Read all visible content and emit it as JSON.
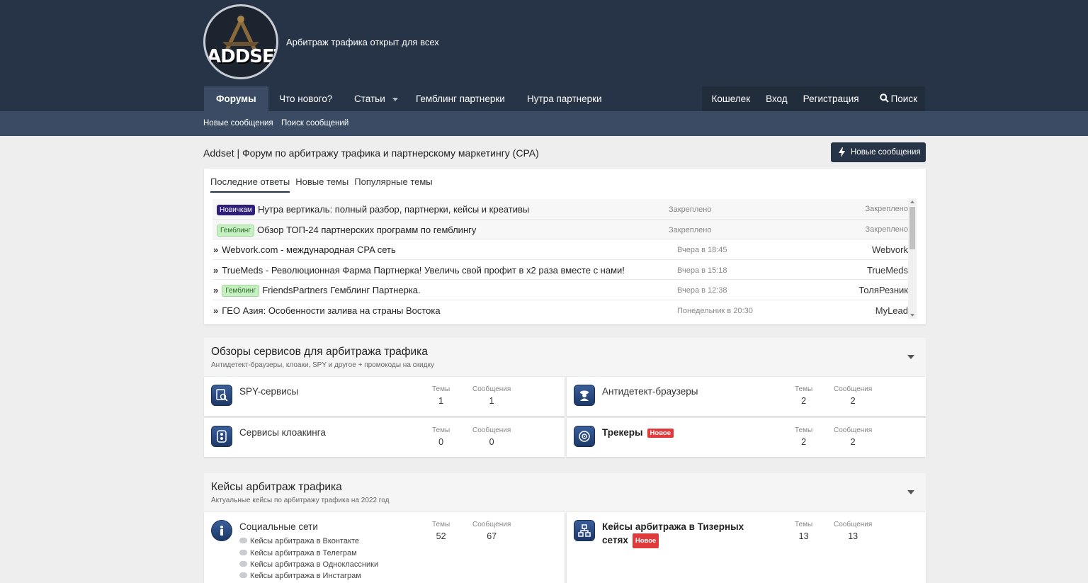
{
  "header": {
    "logo_text": "ADDSET",
    "tagline": "Арбитраж трафика открыт для всех"
  },
  "nav": {
    "items": [
      "Форумы",
      "Что нового?",
      "Статьи",
      "Гемблинг партнерки",
      "Нутра партнерки"
    ],
    "right": [
      "Кошелек",
      "Вход",
      "Регистрация",
      "Поиск"
    ]
  },
  "subnav": [
    "Новые сообщения",
    "Поиск сообщений"
  ],
  "page": {
    "title": "Addset | Форум по арбитражу трафика и партнерскому маркетингу (CPA)",
    "new_posts_button": "Новые сообщения"
  },
  "latest": {
    "tabs": [
      "Последние ответы",
      "Новые темы",
      "Популярные темы"
    ],
    "rows": [
      {
        "label": "Новичкам",
        "label_type": "novice",
        "title": "Нутра вертикаль: полный разбор, партнерки, кейсы и креативы",
        "date": "Закреплено",
        "author": "Закреплено",
        "pinned": true
      },
      {
        "label": "Гемблинг",
        "label_type": "gamble",
        "title": "Обзор ТОП-24 партнерских программ по гемблингу",
        "date": "Закреплено",
        "author": "Закреплено",
        "pinned": true
      },
      {
        "label": "",
        "label_type": "",
        "title": "Webvork.com - международная CPA сеть",
        "date": "Вчера в 18:45",
        "author": "Webvork",
        "pinned": false
      },
      {
        "label": "",
        "label_type": "",
        "title": "TrueMeds - Революционная Фарма Партнерка! Увеличь свой профит в x2 раза вместе с нами!",
        "date": "Вчера в 15:18",
        "author": "TrueMeds",
        "pinned": false
      },
      {
        "label": "Гемблинг",
        "label_type": "gamble",
        "title": "FriendsPartners Гемблинг Партнерка.",
        "date": "Вчера в 12:38",
        "author": "ТоляРезник",
        "pinned": false
      },
      {
        "label": "",
        "label_type": "",
        "title": "ГЕО Азия: Особенности залива на страны Востока",
        "date": "Понедельник в 20:30",
        "author": "MyLead",
        "pinned": false
      }
    ]
  },
  "stats_labels": {
    "topics": "Темы",
    "messages": "Сообщения"
  },
  "categories": [
    {
      "title": "Обзоры сервисов для арбитража трафика",
      "description": "Антидетект-браузеры, клоаки, SPY и другое + промокоды на скидку",
      "forums": [
        {
          "name": "SPY-сервисы",
          "icon": "spy-icon",
          "topics": "1",
          "messages": "1",
          "is_new": false
        },
        {
          "name": "Антидетект-браузеры",
          "icon": "antidetect-icon",
          "topics": "2",
          "messages": "2",
          "is_new": false
        },
        {
          "name": "Сервисы клоакинга",
          "icon": "cloaking-icon",
          "topics": "0",
          "messages": "0",
          "is_new": false
        },
        {
          "name": "Трекеры",
          "icon": "tracker-icon",
          "topics": "2",
          "messages": "2",
          "is_new": true
        }
      ]
    },
    {
      "title": "Кейсы арбитраж трафика",
      "description": "Актуальные кейсы по арбитражу трафика на 2022 год",
      "forums": [
        {
          "name": "Социальные сети",
          "icon": "social-icon",
          "topics": "52",
          "messages": "67",
          "is_new": false,
          "subforums": [
            "Кейсы арбитража в Вконтакте",
            "Кейсы арбитража в Телеграм",
            "Кейсы арбитража в Одноклассники",
            "Кейсы арбитража в Инстаграм"
          ]
        },
        {
          "name_line1": "Кейсы арбитража в Тизерных",
          "name_line2": "сетях",
          "icon": "teaser-icon",
          "topics": "13",
          "messages": "13",
          "is_new": true
        }
      ]
    }
  ],
  "new_badge": "Новое"
}
